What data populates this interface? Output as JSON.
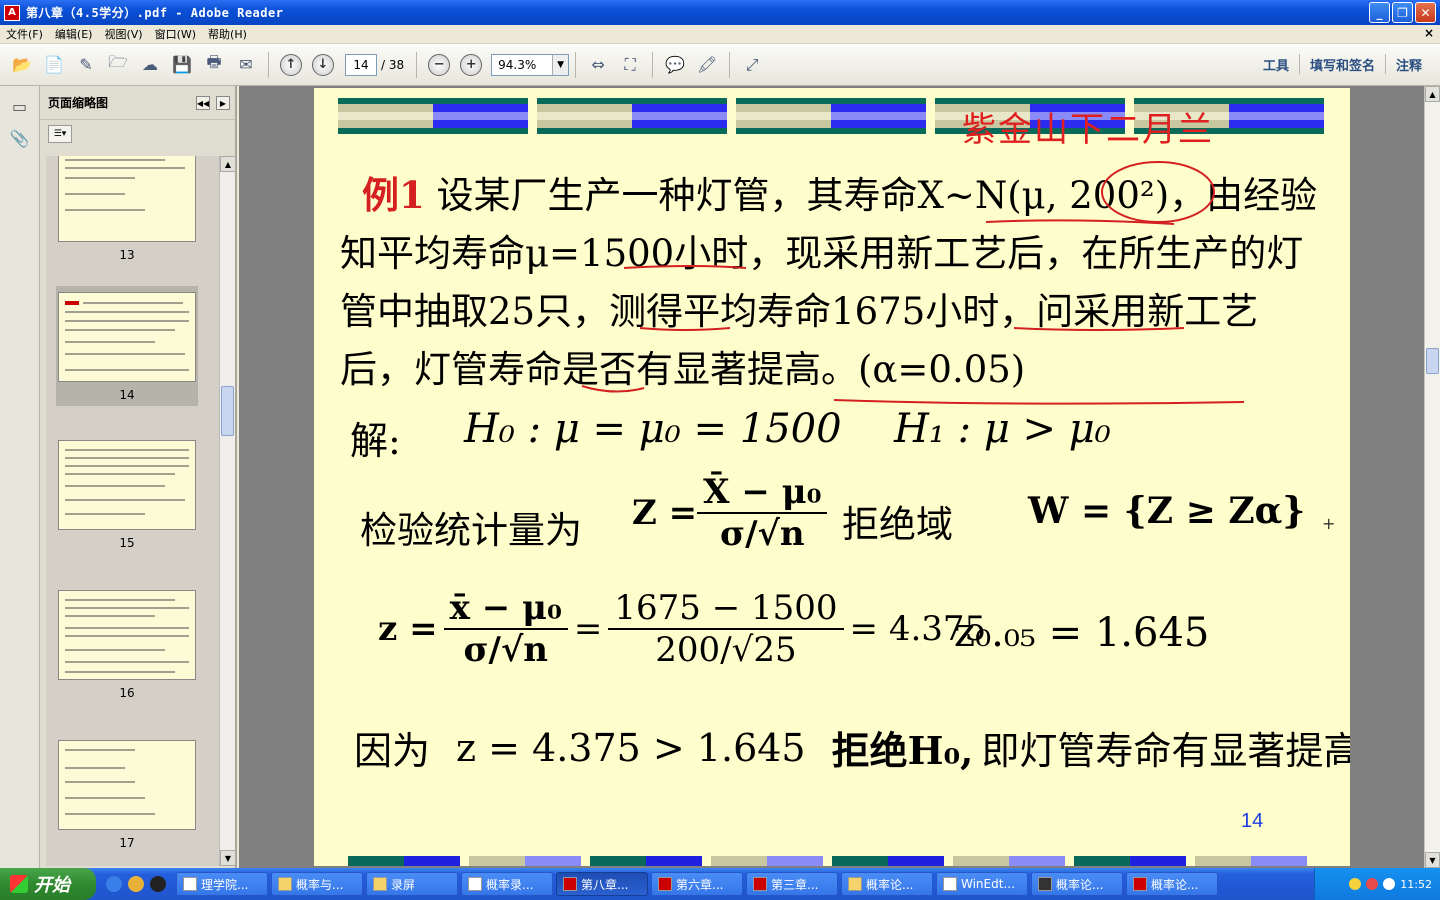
{
  "window": {
    "title": "第八章（4.5学分）.pdf - Adobe Reader",
    "icon": "adobe-reader-icon"
  },
  "menu": [
    "文件(F)",
    "编辑(E)",
    "视图(V)",
    "窗口(W)",
    "帮助(H)"
  ],
  "toolbar": {
    "page_current": "14",
    "page_total": "/ 38",
    "zoom": "94.3%",
    "right_links": [
      "工具",
      "填写和签名",
      "注释"
    ]
  },
  "thumbnails": {
    "header": "页面缩略图",
    "pages": [
      "13",
      "14",
      "15",
      "16",
      "17"
    ],
    "selected": "14"
  },
  "slide": {
    "watermark": "紫金山下二月兰",
    "example_label": "例1",
    "problem_text": "设某厂生产一种灯管，其寿命X~N(μ, 200²)，由经验知平均寿命μ=1500小时，现采用新工艺后，在所生产的灯管中抽取25只，测得平均寿命1675小时，问采用新工艺后，灯管寿命是否有显著提高。(α=0.05)",
    "solution_label": "解:",
    "h0": "H₀ : μ = μ₀ = 1500",
    "h1": "H₁ : μ > μ₀",
    "stat_label": "检验统计量为",
    "stat_z": "Z =",
    "stat_num": "X̄ − μ₀",
    "stat_den": "σ/√n",
    "reject_label": "拒绝域",
    "reject_region": "W = {Z ≥ Zα}",
    "calc_z": "z =",
    "calc_num1": "x̄ − μ₀",
    "calc_den1": "σ/√n",
    "calc_eq": "=",
    "calc_num2": "1675 − 1500",
    "calc_den2": "200/√25",
    "calc_result": "= 4.375",
    "crit_value": "z₀.₀₅ = 1.645",
    "conclusion_label": "因为",
    "conclusion_math": "z = 4.375 > 1.645",
    "conclusion_reject": "拒绝H₀,",
    "conclusion_text": "即灯管寿命有显著提高",
    "page_number": "14"
  },
  "taskbar": {
    "start": "开始",
    "tasks": [
      "理学院...",
      "概率与...",
      "录屏",
      "概率录...",
      "第八章...",
      "第六章...",
      "第三章...",
      "概率论...",
      "WinEdt...",
      "概率论...",
      "概率论..."
    ],
    "active_task": "第八章...",
    "clock": "11:52"
  }
}
